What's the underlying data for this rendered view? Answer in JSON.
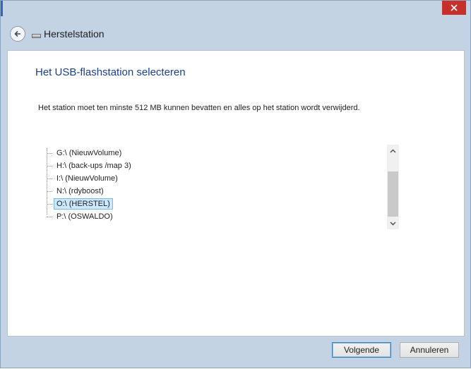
{
  "window": {
    "title": "Herstelstation",
    "accent_close": "#c7302a"
  },
  "icons": {
    "back": "back-arrow-icon",
    "drive": "drive-icon",
    "close": "close-icon"
  },
  "page": {
    "heading": "Het USB-flashstation selecteren",
    "description": "Het station moet ten minste 512 MB kunnen bevatten en alles op het station wordt verwijderd."
  },
  "drives": [
    {
      "label": "G:\\ (NieuwVolume)",
      "selected": false
    },
    {
      "label": "H:\\ (back-ups /map 3)",
      "selected": false
    },
    {
      "label": "I:\\ (NieuwVolume)",
      "selected": false
    },
    {
      "label": "N:\\ (rdyboost)",
      "selected": false
    },
    {
      "label": "O:\\ (HERSTEL)",
      "selected": true
    },
    {
      "label": "P:\\ (OSWALDO)",
      "selected": false
    }
  ],
  "footer": {
    "next_label": "Volgende",
    "cancel_label": "Annuleren"
  }
}
